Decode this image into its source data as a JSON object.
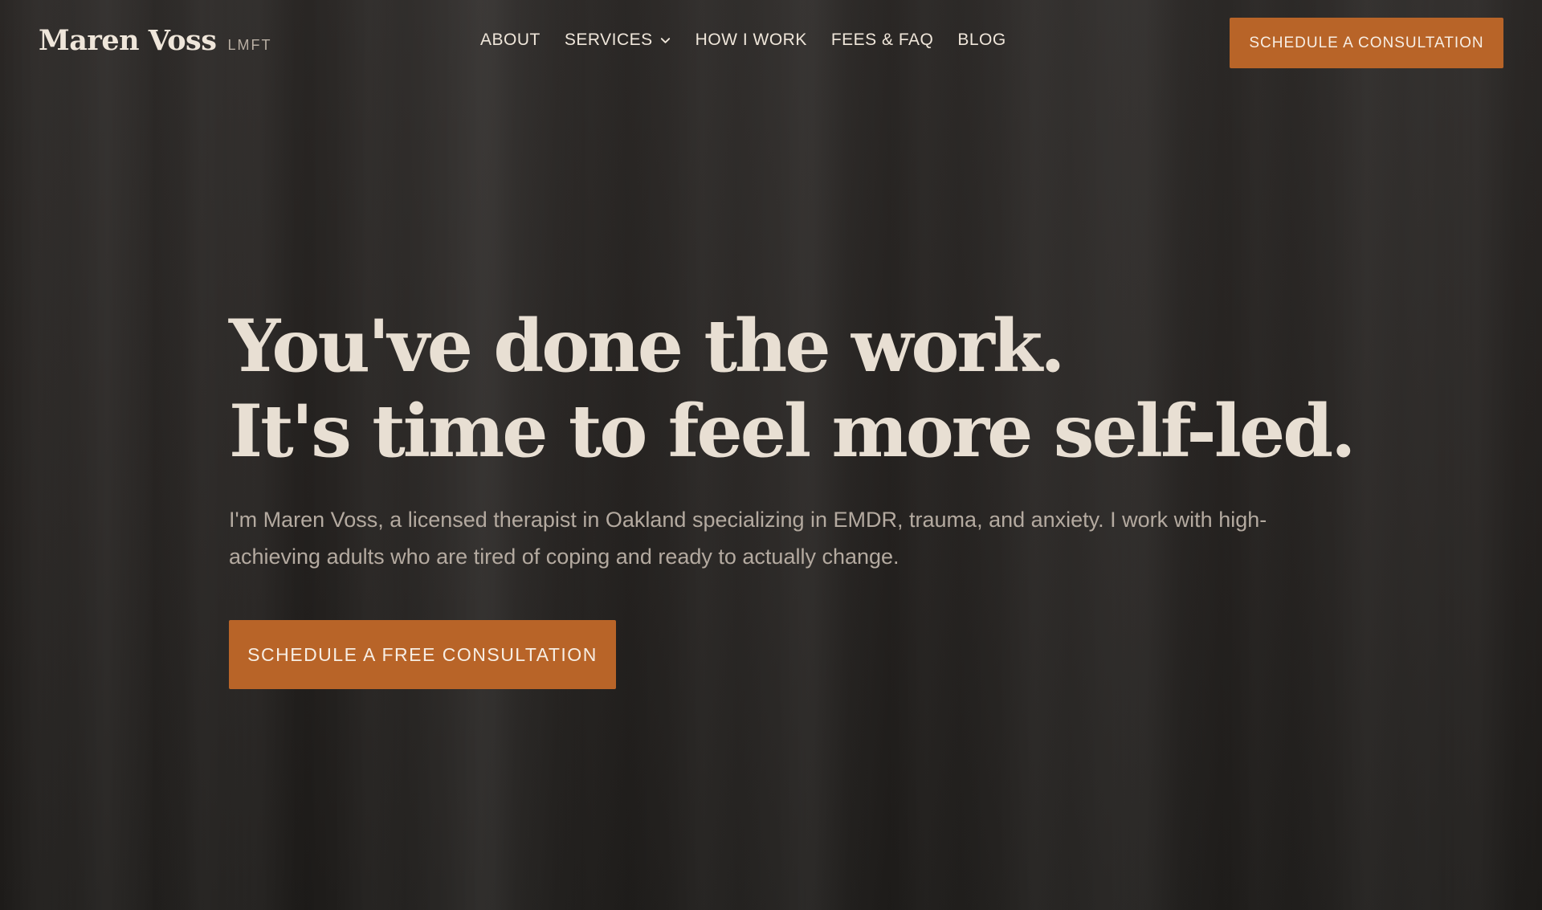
{
  "brand": {
    "name": "Maren Voss",
    "credential": "LMFT"
  },
  "nav": {
    "items": [
      {
        "label": "ABOUT",
        "icon": null
      },
      {
        "label": "SERVICES",
        "icon": "chevron-down-icon"
      },
      {
        "label": "HOW I WORK",
        "icon": null
      },
      {
        "label": "FEES & FAQ",
        "icon": null
      },
      {
        "label": "BLOG",
        "icon": null
      }
    ]
  },
  "header_cta": {
    "label": "SCHEDULE A CONSULTATION"
  },
  "hero": {
    "headline_line1": "You've done the work.",
    "headline_line2": "It's time to feel more self-led.",
    "subtext": "I'm Maren Voss, a licensed therapist in Oakland specializing in EMDR, trauma, and anxiety. I work with high-achieving adults who are tired of coping and ready to actually change.",
    "cta_label": "SCHEDULE A FREE CONSULTATION"
  },
  "colors": {
    "accent": "#b86428",
    "background": "#24211f",
    "headline": "#e8dfd3",
    "subtext": "#b4aaa0"
  }
}
